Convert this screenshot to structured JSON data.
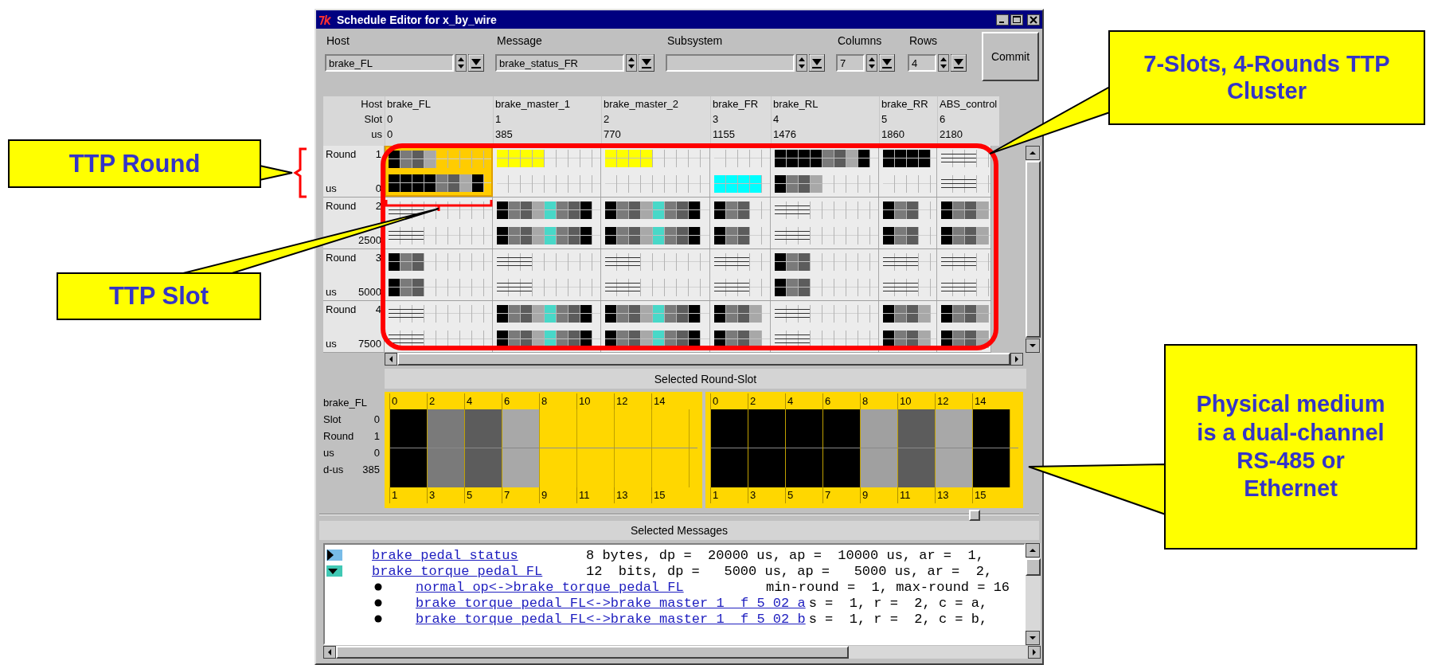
{
  "window": {
    "title": "Schedule Editor for x_by_wire"
  },
  "controls": [
    {
      "label": "Host",
      "value": "brake_FL",
      "kind": "wide"
    },
    {
      "label": "Message",
      "value": "brake_status_FR",
      "kind": "wide"
    },
    {
      "label": "Subsystem",
      "kind": "wide"
    },
    {
      "label": "Columns",
      "value": "7",
      "kind": "narrow"
    },
    {
      "label": "Rows",
      "value": "4",
      "kind": "narrow"
    }
  ],
  "commit_button": "Commit",
  "grid": {
    "header_labels": [
      "Host",
      "Slot",
      "us"
    ],
    "slots": [
      {
        "host": "brake_FL",
        "slot": "0",
        "us": "0"
      },
      {
        "host": "brake_master_1",
        "slot": "1",
        "us": "385"
      },
      {
        "host": "brake_master_2",
        "slot": "2",
        "us": "770"
      },
      {
        "host": "brake_FR",
        "slot": "3",
        "us": "1155"
      },
      {
        "host": "brake_RL",
        "slot": "4",
        "us": "1476"
      },
      {
        "host": "brake_RR",
        "slot": "5",
        "us": "1860"
      },
      {
        "host": "ABS_control",
        "slot": "6",
        "us": "2180"
      }
    ],
    "rounds": [
      {
        "round_label": "Round",
        "round": "1",
        "us_label": "us",
        "us": "0",
        "cells": [
          {
            "selected": true,
            "channel_a": [
              {
                "kind": "fill",
                "color": "#000000"
              },
              {
                "kind": "fill",
                "color": "#7a7a7a"
              },
              {
                "kind": "fill",
                "color": "#5c5c5c"
              },
              {
                "kind": "fill",
                "color": "#a8a8a8"
              }
            ],
            "channel_b": [
              {
                "kind": "fill",
                "color": "#000000"
              },
              {
                "kind": "fill",
                "color": "#000000"
              },
              {
                "kind": "fill",
                "color": "#000000"
              },
              {
                "kind": "fill",
                "color": "#000000"
              },
              {
                "kind": "fill",
                "color": "#7a7a7a"
              },
              {
                "kind": "fill",
                "color": "#5c5c5c"
              },
              {
                "kind": "fill",
                "color": "#a8a8a8"
              },
              {
                "kind": "fill",
                "color": "#000000"
              }
            ]
          },
          {
            "selected": false,
            "channel_a": [
              {
                "kind": "fill",
                "color": "#ffff00"
              },
              {
                "kind": "fill",
                "color": "#ffff00"
              },
              {
                "kind": "fill",
                "color": "#ffff00"
              },
              {
                "kind": "fill",
                "color": "#ffff00"
              }
            ]
          },
          {
            "selected": false,
            "channel_a": [
              {
                "kind": "fill",
                "color": "#ffff00"
              },
              {
                "kind": "fill",
                "color": "#ffff00"
              },
              {
                "kind": "fill",
                "color": "#ffff00"
              },
              {
                "kind": "fill",
                "color": "#ffff00"
              }
            ]
          },
          {
            "selected": false,
            "channel_b": [
              {
                "kind": "fill",
                "color": "#00ffff"
              },
              {
                "kind": "fill",
                "color": "#00ffff"
              },
              {
                "kind": "fill",
                "color": "#00ffff"
              },
              {
                "kind": "fill",
                "color": "#00ffff"
              }
            ]
          },
          {
            "selected": false,
            "channel_a": [
              {
                "kind": "fill",
                "color": "#000000"
              },
              {
                "kind": "fill",
                "color": "#000000"
              },
              {
                "kind": "fill",
                "color": "#000000"
              },
              {
                "kind": "fill",
                "color": "#000000"
              },
              {
                "kind": "fill",
                "color": "#7a7a7a"
              },
              {
                "kind": "fill",
                "color": "#5c5c5c"
              },
              {
                "kind": "fill",
                "color": "#a8a8a8"
              },
              {
                "kind": "fill",
                "color": "#000000"
              }
            ],
            "channel_b": [
              {
                "kind": "fill",
                "color": "#000000"
              },
              {
                "kind": "fill",
                "color": "#7a7a7a"
              },
              {
                "kind": "fill",
                "color": "#5c5c5c"
              },
              {
                "kind": "fill",
                "color": "#a8a8a8"
              }
            ]
          },
          {
            "selected": false,
            "channel_a": [
              {
                "kind": "fill",
                "color": "#000000"
              },
              {
                "kind": "fill",
                "color": "#000000"
              },
              {
                "kind": "fill",
                "color": "#000000"
              },
              {
                "kind": "fill",
                "color": "#000000"
              }
            ]
          },
          {
            "selected": false,
            "channel_a": [
              {
                "kind": "lines"
              }
            ],
            "channel_b": [
              {
                "kind": "lines"
              }
            ]
          }
        ]
      },
      {
        "round_label": "Round",
        "round": "2",
        "us": "2500",
        "cells": [
          {
            "selected": false,
            "channel_a": [
              {
                "kind": "lines"
              }
            ],
            "channel_b": [
              {
                "kind": "lines"
              }
            ]
          },
          {
            "selected": false,
            "channel_a": [
              {
                "kind": "fill",
                "color": "#000000"
              },
              {
                "kind": "fill",
                "color": "#7a7a7a"
              },
              {
                "kind": "fill",
                "color": "#5c5c5c"
              },
              {
                "kind": "fill",
                "color": "#a8a8a8"
              },
              {
                "kind": "fill",
                "color": "#48d8c8"
              },
              {
                "kind": "fill",
                "color": "#7a7a7a"
              },
              {
                "kind": "fill",
                "color": "#5c5c5c"
              },
              {
                "kind": "fill",
                "color": "#000000"
              }
            ],
            "channel_b": [
              {
                "kind": "fill",
                "color": "#000000"
              },
              {
                "kind": "fill",
                "color": "#7a7a7a"
              },
              {
                "kind": "fill",
                "color": "#5c5c5c"
              },
              {
                "kind": "fill",
                "color": "#a8a8a8"
              },
              {
                "kind": "fill",
                "color": "#48d8c8"
              },
              {
                "kind": "fill",
                "color": "#7a7a7a"
              },
              {
                "kind": "fill",
                "color": "#5c5c5c"
              },
              {
                "kind": "fill",
                "color": "#000000"
              }
            ]
          },
          {
            "selected": false,
            "channel_a": [
              {
                "kind": "fill",
                "color": "#000000"
              },
              {
                "kind": "fill",
                "color": "#7a7a7a"
              },
              {
                "kind": "fill",
                "color": "#5c5c5c"
              },
              {
                "kind": "fill",
                "color": "#a8a8a8"
              },
              {
                "kind": "fill",
                "color": "#48d8c8"
              },
              {
                "kind": "fill",
                "color": "#7a7a7a"
              },
              {
                "kind": "fill",
                "color": "#5c5c5c"
              },
              {
                "kind": "fill",
                "color": "#000000"
              }
            ],
            "channel_b": [
              {
                "kind": "fill",
                "color": "#000000"
              },
              {
                "kind": "fill",
                "color": "#7a7a7a"
              },
              {
                "kind": "fill",
                "color": "#5c5c5c"
              },
              {
                "kind": "fill",
                "color": "#a8a8a8"
              },
              {
                "kind": "fill",
                "color": "#48d8c8"
              },
              {
                "kind": "fill",
                "color": "#7a7a7a"
              },
              {
                "kind": "fill",
                "color": "#5c5c5c"
              },
              {
                "kind": "fill",
                "color": "#000000"
              }
            ]
          },
          {
            "selected": false,
            "channel_a": [
              {
                "kind": "fill",
                "color": "#000000"
              },
              {
                "kind": "fill",
                "color": "#7a7a7a"
              },
              {
                "kind": "fill",
                "color": "#5c5c5c"
              }
            ],
            "channel_b": [
              {
                "kind": "fill",
                "color": "#000000"
              },
              {
                "kind": "fill",
                "color": "#7a7a7a"
              },
              {
                "kind": "fill",
                "color": "#5c5c5c"
              }
            ]
          },
          {
            "selected": false,
            "channel_a": [
              {
                "kind": "lines"
              }
            ],
            "channel_b": [
              {
                "kind": "lines"
              }
            ]
          },
          {
            "selected": false,
            "channel_a": [
              {
                "kind": "fill",
                "color": "#000000"
              },
              {
                "kind": "fill",
                "color": "#7a7a7a"
              },
              {
                "kind": "fill",
                "color": "#5c5c5c"
              }
            ],
            "channel_b": [
              {
                "kind": "fill",
                "color": "#000000"
              },
              {
                "kind": "fill",
                "color": "#7a7a7a"
              },
              {
                "kind": "fill",
                "color": "#5c5c5c"
              }
            ]
          },
          {
            "selected": false,
            "channel_a": [
              {
                "kind": "fill",
                "color": "#000000"
              },
              {
                "kind": "fill",
                "color": "#7a7a7a"
              },
              {
                "kind": "fill",
                "color": "#5c5c5c"
              },
              {
                "kind": "fill",
                "color": "#a8a8a8"
              }
            ],
            "channel_b": [
              {
                "kind": "fill",
                "color": "#000000"
              },
              {
                "kind": "fill",
                "color": "#7a7a7a"
              },
              {
                "kind": "fill",
                "color": "#5c5c5c"
              },
              {
                "kind": "fill",
                "color": "#a8a8a8"
              }
            ]
          }
        ]
      },
      {
        "round_label": "Round",
        "round": "3",
        "us_label": "us",
        "us": "5000",
        "cells": [
          {
            "selected": false,
            "channel_a": [
              {
                "kind": "fill",
                "color": "#000000"
              },
              {
                "kind": "fill",
                "color": "#7a7a7a"
              },
              {
                "kind": "fill",
                "color": "#5c5c5c"
              }
            ],
            "channel_b": [
              {
                "kind": "fill",
                "color": "#000000"
              },
              {
                "kind": "fill",
                "color": "#7a7a7a"
              },
              {
                "kind": "fill",
                "color": "#5c5c5c"
              }
            ]
          },
          {
            "selected": false,
            "channel_a": [
              {
                "kind": "lines"
              }
            ],
            "channel_b": [
              {
                "kind": "lines"
              }
            ]
          },
          {
            "selected": false,
            "channel_a": [
              {
                "kind": "lines"
              }
            ],
            "channel_b": [
              {
                "kind": "lines"
              }
            ]
          },
          {
            "selected": false,
            "channel_a": [
              {
                "kind": "lines"
              }
            ],
            "channel_b": [
              {
                "kind": "lines"
              }
            ]
          },
          {
            "selected": false,
            "channel_a": [
              {
                "kind": "fill",
                "color": "#000000"
              },
              {
                "kind": "fill",
                "color": "#7a7a7a"
              },
              {
                "kind": "fill",
                "color": "#5c5c5c"
              }
            ],
            "channel_b": [
              {
                "kind": "fill",
                "color": "#000000"
              },
              {
                "kind": "fill",
                "color": "#7a7a7a"
              },
              {
                "kind": "fill",
                "color": "#5c5c5c"
              }
            ]
          },
          {
            "selected": false,
            "channel_a": [
              {
                "kind": "lines"
              }
            ],
            "channel_b": [
              {
                "kind": "lines"
              }
            ]
          },
          {
            "selected": false,
            "channel_a": [
              {
                "kind": "lines"
              }
            ],
            "channel_b": [
              {
                "kind": "lines"
              }
            ]
          }
        ]
      },
      {
        "round_label": "Round",
        "round": "4",
        "us_label": "us",
        "us": "7500",
        "cells": [
          {
            "selected": false,
            "channel_a": [
              {
                "kind": "lines"
              }
            ],
            "channel_b": [
              {
                "kind": "lines"
              }
            ]
          },
          {
            "selected": false,
            "channel_a": [
              {
                "kind": "fill",
                "color": "#000000"
              },
              {
                "kind": "fill",
                "color": "#7a7a7a"
              },
              {
                "kind": "fill",
                "color": "#5c5c5c"
              },
              {
                "kind": "fill",
                "color": "#a8a8a8"
              },
              {
                "kind": "fill",
                "color": "#48d8c8"
              },
              {
                "kind": "fill",
                "color": "#7a7a7a"
              },
              {
                "kind": "fill",
                "color": "#5c5c5c"
              },
              {
                "kind": "fill",
                "color": "#000000"
              }
            ],
            "channel_b": [
              {
                "kind": "fill",
                "color": "#000000"
              },
              {
                "kind": "fill",
                "color": "#7a7a7a"
              },
              {
                "kind": "fill",
                "color": "#5c5c5c"
              },
              {
                "kind": "fill",
                "color": "#a8a8a8"
              },
              {
                "kind": "fill",
                "color": "#48d8c8"
              },
              {
                "kind": "fill",
                "color": "#7a7a7a"
              },
              {
                "kind": "fill",
                "color": "#5c5c5c"
              },
              {
                "kind": "fill",
                "color": "#000000"
              }
            ]
          },
          {
            "selected": false,
            "channel_a": [
              {
                "kind": "fill",
                "color": "#000000"
              },
              {
                "kind": "fill",
                "color": "#7a7a7a"
              },
              {
                "kind": "fill",
                "color": "#5c5c5c"
              },
              {
                "kind": "fill",
                "color": "#a8a8a8"
              },
              {
                "kind": "fill",
                "color": "#48d8c8"
              },
              {
                "kind": "fill",
                "color": "#7a7a7a"
              },
              {
                "kind": "fill",
                "color": "#5c5c5c"
              },
              {
                "kind": "fill",
                "color": "#000000"
              }
            ],
            "channel_b": [
              {
                "kind": "fill",
                "color": "#000000"
              },
              {
                "kind": "fill",
                "color": "#7a7a7a"
              },
              {
                "kind": "fill",
                "color": "#5c5c5c"
              },
              {
                "kind": "fill",
                "color": "#a8a8a8"
              },
              {
                "kind": "fill",
                "color": "#48d8c8"
              },
              {
                "kind": "fill",
                "color": "#7a7a7a"
              },
              {
                "kind": "fill",
                "color": "#5c5c5c"
              },
              {
                "kind": "fill",
                "color": "#000000"
              }
            ]
          },
          {
            "selected": false,
            "channel_a": [
              {
                "kind": "fill",
                "color": "#000000"
              },
              {
                "kind": "fill",
                "color": "#7a7a7a"
              },
              {
                "kind": "fill",
                "color": "#5c5c5c"
              },
              {
                "kind": "fill",
                "color": "#a8a8a8"
              }
            ],
            "channel_b": [
              {
                "kind": "fill",
                "color": "#000000"
              },
              {
                "kind": "fill",
                "color": "#7a7a7a"
              },
              {
                "kind": "fill",
                "color": "#5c5c5c"
              },
              {
                "kind": "fill",
                "color": "#a8a8a8"
              }
            ]
          },
          {
            "selected": false,
            "channel_a": [
              {
                "kind": "lines"
              }
            ],
            "channel_b": [
              {
                "kind": "lines"
              }
            ]
          },
          {
            "selected": false,
            "channel_a": [
              {
                "kind": "fill",
                "color": "#000000"
              },
              {
                "kind": "fill",
                "color": "#7a7a7a"
              },
              {
                "kind": "fill",
                "color": "#5c5c5c"
              },
              {
                "kind": "fill",
                "color": "#a8a8a8"
              }
            ],
            "channel_b": [
              {
                "kind": "fill",
                "color": "#000000"
              },
              {
                "kind": "fill",
                "color": "#7a7a7a"
              },
              {
                "kind": "fill",
                "color": "#5c5c5c"
              },
              {
                "kind": "fill",
                "color": "#a8a8a8"
              }
            ]
          },
          {
            "selected": false,
            "channel_a": [
              {
                "kind": "fill",
                "color": "#000000"
              },
              {
                "kind": "fill",
                "color": "#7a7a7a"
              },
              {
                "kind": "fill",
                "color": "#5c5c5c"
              },
              {
                "kind": "fill",
                "color": "#a8a8a8"
              }
            ],
            "channel_b": [
              {
                "kind": "fill",
                "color": "#000000"
              },
              {
                "kind": "fill",
                "color": "#7a7a7a"
              },
              {
                "kind": "fill",
                "color": "#5c5c5c"
              },
              {
                "kind": "fill",
                "color": "#a8a8a8"
              }
            ]
          }
        ]
      }
    ]
  },
  "selected_round_slot": {
    "title": "Selected Round-Slot",
    "info": [
      {
        "label": "brake_FL"
      },
      {
        "label": "Slot",
        "value": "0"
      },
      {
        "label": "Round",
        "value": "1"
      },
      {
        "label": "us",
        "value": "0"
      },
      {
        "label": "d-us",
        "value": "385"
      }
    ],
    "channels": [
      {
        "top_ticks": [
          "0",
          "2",
          "4",
          "6",
          "8",
          "10",
          "12",
          "14"
        ],
        "bottom_ticks": [
          "1",
          "3",
          "5",
          "7",
          "9",
          "11",
          "13",
          "15"
        ],
        "blocks": [
          {
            "kind": "fill",
            "color": "#000000"
          },
          {
            "kind": "fill",
            "color": "#7a7a7a"
          },
          {
            "kind": "fill",
            "color": "#5c5c5c"
          },
          {
            "kind": "fill",
            "color": "#a8a8a8"
          }
        ]
      },
      {
        "top_ticks": [
          "0",
          "2",
          "4",
          "6",
          "8",
          "10",
          "12",
          "14"
        ],
        "bottom_ticks": [
          "1",
          "3",
          "5",
          "7",
          "9",
          "11",
          "13",
          "15"
        ],
        "blocks": [
          {
            "kind": "fill",
            "color": "#000000"
          },
          {
            "kind": "fill",
            "color": "#000000"
          },
          {
            "kind": "fill",
            "color": "#000000"
          },
          {
            "kind": "fill",
            "color": "#000000"
          },
          {
            "kind": "fill",
            "color": "#a0a0a0"
          },
          {
            "kind": "fill",
            "color": "#5c5c5c"
          },
          {
            "kind": "fill",
            "color": "#a8a8a8"
          },
          {
            "kind": "fill",
            "color": "#000000"
          }
        ]
      }
    ]
  },
  "slider": {
    "level": 0.91
  },
  "selected_messages": {
    "title": "Selected Messages",
    "rows": [
      {
        "kind": "message",
        "expanded": false,
        "link": "brake_pedal_status",
        "detail": "8 bytes, dp =  20000 us, ap =  10000 us, ar =  1,"
      },
      {
        "kind": "message",
        "expanded": true,
        "link": "brake_torque_pedal_FL",
        "detail": "12  bits, dp =   5000 us, ap =   5000 us, ar =  2,"
      },
      {
        "kind": "route",
        "link": "normal_op<->brake_torque_pedal_FL",
        "detail": "min-round =  1, max-round = 16"
      },
      {
        "kind": "route",
        "link": "brake_torque_pedal_FL<->brake_master_1__f_5_02_a",
        "detail": "s =  1, r =  2, c = a,"
      },
      {
        "kind": "route",
        "link": "brake_torque_pedal_FL<->brake_master_1__f_5_02_b",
        "detail": "s =  1, r =  2, c = b,"
      }
    ]
  },
  "callouts": [
    {
      "text": "TTP Round"
    },
    {
      "text": "TTP Slot"
    },
    {
      "text": "7-Slots, 4-Rounds TTP Cluster"
    },
    {
      "text": "Physical medium is a dual-channel RS-485 or Ethernet"
    }
  ]
}
